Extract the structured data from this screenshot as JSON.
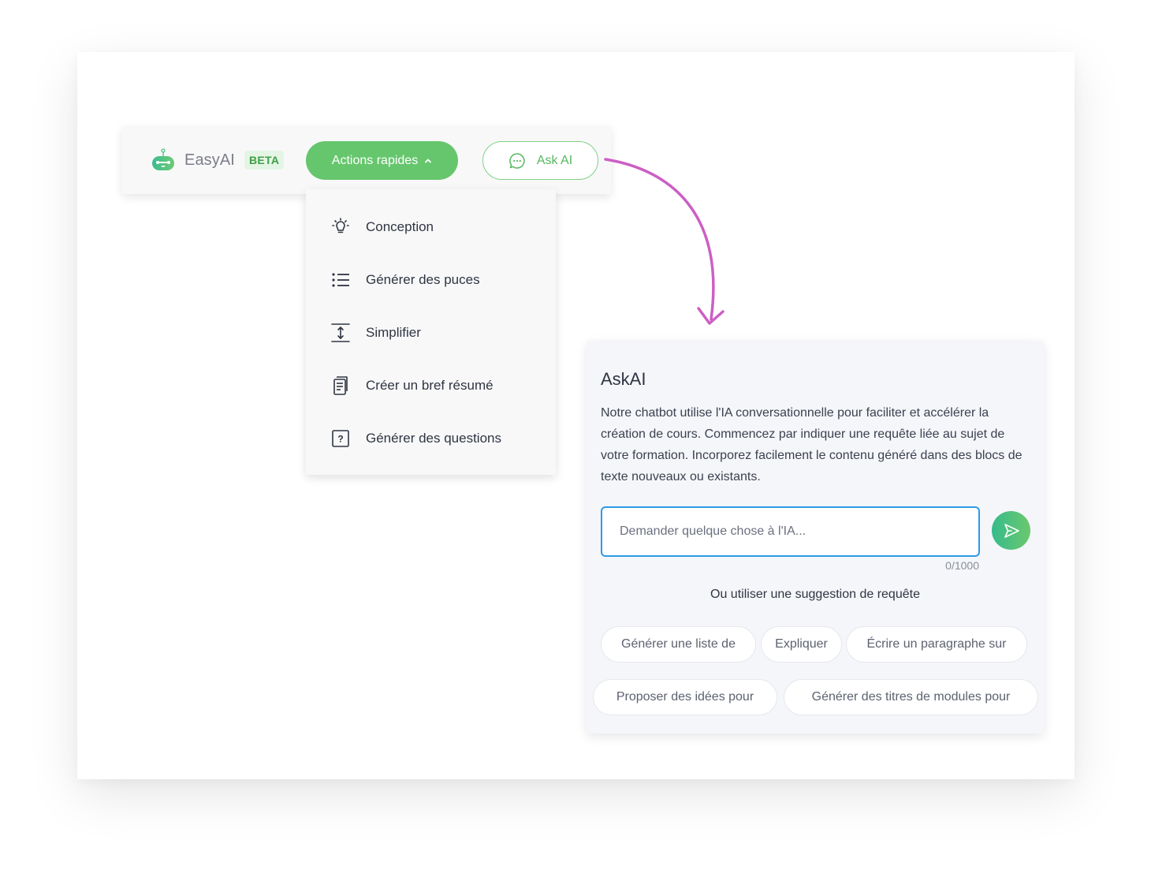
{
  "toolbar": {
    "brand_name": "EasyAI",
    "beta_badge": "BETA",
    "actions_button_label": "Actions rapides",
    "ask_ai_button_label": "Ask AI"
  },
  "dropdown": {
    "items": [
      {
        "label": "Conception",
        "icon": "lightbulb-icon"
      },
      {
        "label": "Générer des puces",
        "icon": "bullet-list-icon"
      },
      {
        "label": "Simplifier",
        "icon": "vertical-expand-icon"
      },
      {
        "label": "Créer un bref résumé",
        "icon": "documents-icon"
      },
      {
        "label": "Générer des questions",
        "icon": "question-box-icon"
      }
    ]
  },
  "panel": {
    "title": "AskAI",
    "description": "Notre chatbot utilise l'IA conversationnelle pour faciliter et accélérer la création de cours. Commencez par indiquer une requête liée au sujet de votre formation. Incorporez facilement le contenu généré dans des blocs de texte nouveaux ou existants.",
    "input_value": "",
    "input_placeholder": "Demander quelque chose à l'IA...",
    "char_count": "0/1000",
    "suggestions_title": "Ou utiliser une suggestion de requête",
    "suggestions": [
      "Générer une liste de",
      "Expliquer",
      "Écrire un paragraphe sur",
      "Proposer des idées pour",
      "Générer des titres de modules pour"
    ]
  },
  "colors": {
    "brand_green": "#66c66d",
    "annotation_arrow": "#cc5fc4",
    "input_focus": "#2d9be6"
  }
}
